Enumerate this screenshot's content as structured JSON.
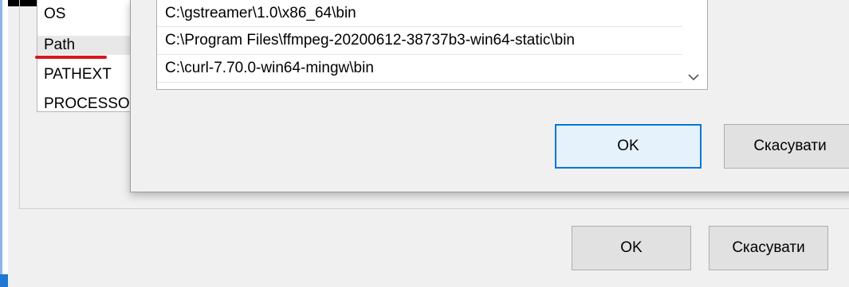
{
  "env_list": {
    "items": [
      "OS",
      "Path",
      "PATHEXT",
      "PROCESSO"
    ]
  },
  "path_dialog": {
    "entries": [
      "C:\\gstreamer\\1.0\\x86_64\\bin",
      "C:\\Program Files\\ffmpeg-20200612-38737b3-win64-static\\bin",
      "C:\\curl-7.70.0-win64-mingw\\bin"
    ],
    "ok_label": "OK",
    "cancel_label": "Скасувати"
  },
  "main_dialog": {
    "ok_label": "OK",
    "cancel_label": "Скасувати"
  },
  "icons": {
    "scroll_down": "chevron-down-icon"
  },
  "colors": {
    "accent": "#0078d7",
    "highlight_underline": "#d7171f"
  }
}
